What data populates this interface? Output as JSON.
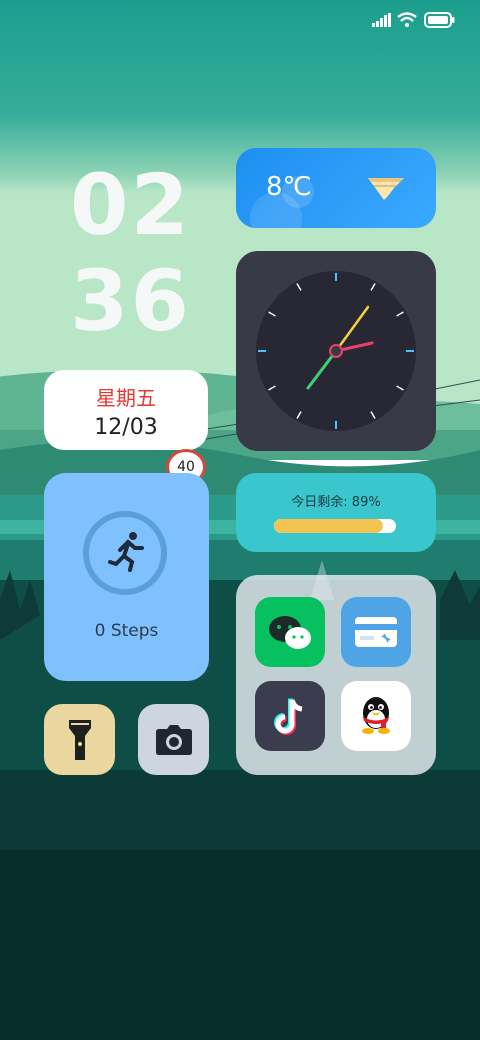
{
  "status_bar": {
    "signal_icon": "signal-icon",
    "wifi_icon": "wifi-icon",
    "battery_icon": "battery-icon"
  },
  "clock": {
    "hour": "02",
    "minute": "36"
  },
  "date_widget": {
    "weekday": "星期五",
    "date": "12/03"
  },
  "weather_widget": {
    "temperature": "8℃",
    "icon": "tornado-icon"
  },
  "speed_badge": {
    "value": "40"
  },
  "steps_widget": {
    "label": "0 Steps",
    "icon": "running-icon"
  },
  "battery_widget": {
    "label": "今日剩余: 89%",
    "percent": 0.89
  },
  "apps": [
    {
      "name": "wechat-app-icon"
    },
    {
      "name": "wallet-app-icon"
    },
    {
      "name": "tiktok-app-icon"
    },
    {
      "name": "qq-app-icon"
    }
  ],
  "quick_buttons": [
    {
      "name": "flashlight-icon"
    },
    {
      "name": "camera-icon"
    }
  ],
  "colors": {
    "accent": "#1d8ff0",
    "steps_card": "#7fc1ff",
    "battery_card": "#39c6cd",
    "clock_card": "#383a48"
  }
}
